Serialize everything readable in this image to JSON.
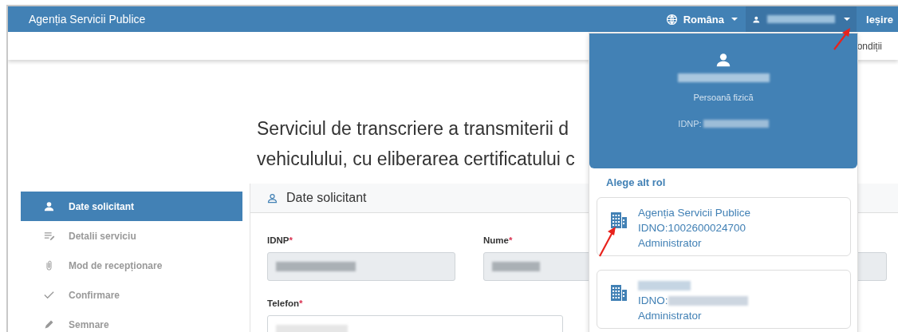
{
  "header": {
    "brand": "Agenția Servicii Publice",
    "language": "Româna",
    "logout": "Ieșire"
  },
  "subbar": {
    "link": "ondiții"
  },
  "page_title_lines": [
    "Serviciul de transcriere a transmiterii d",
    "vehiculului, cu eliberarea certificatului c"
  ],
  "steps": [
    {
      "label": "Date solicitant",
      "selected": true,
      "kind": "person"
    },
    {
      "label": "Detalii serviciu",
      "selected": false,
      "kind": "edit"
    },
    {
      "label": "Mod de recepționare",
      "selected": false,
      "kind": "clip"
    },
    {
      "label": "Confirmare",
      "selected": false,
      "kind": "check"
    },
    {
      "label": "Semnare",
      "selected": false,
      "kind": "sign"
    }
  ],
  "section": {
    "title": "Date solicitant",
    "fields": [
      {
        "label": "IDNP",
        "required_mark": "*",
        "disabled": true
      },
      {
        "label": "Nume",
        "required_mark": "*",
        "disabled": true
      },
      {
        "label": "Telefon",
        "required_mark": "*",
        "disabled": false
      }
    ]
  },
  "user_menu": {
    "expanded": true,
    "person_type": "Persoană fizică",
    "idnp_label": "IDNP:",
    "roles_heading": "Alege alt rol",
    "roles": [
      {
        "name": "Agenția Servicii Publice",
        "idno": "IDNO:1002600024700",
        "role": "Administrator"
      },
      {
        "idno": "IDNO:",
        "role": "Administrator"
      }
    ]
  }
}
